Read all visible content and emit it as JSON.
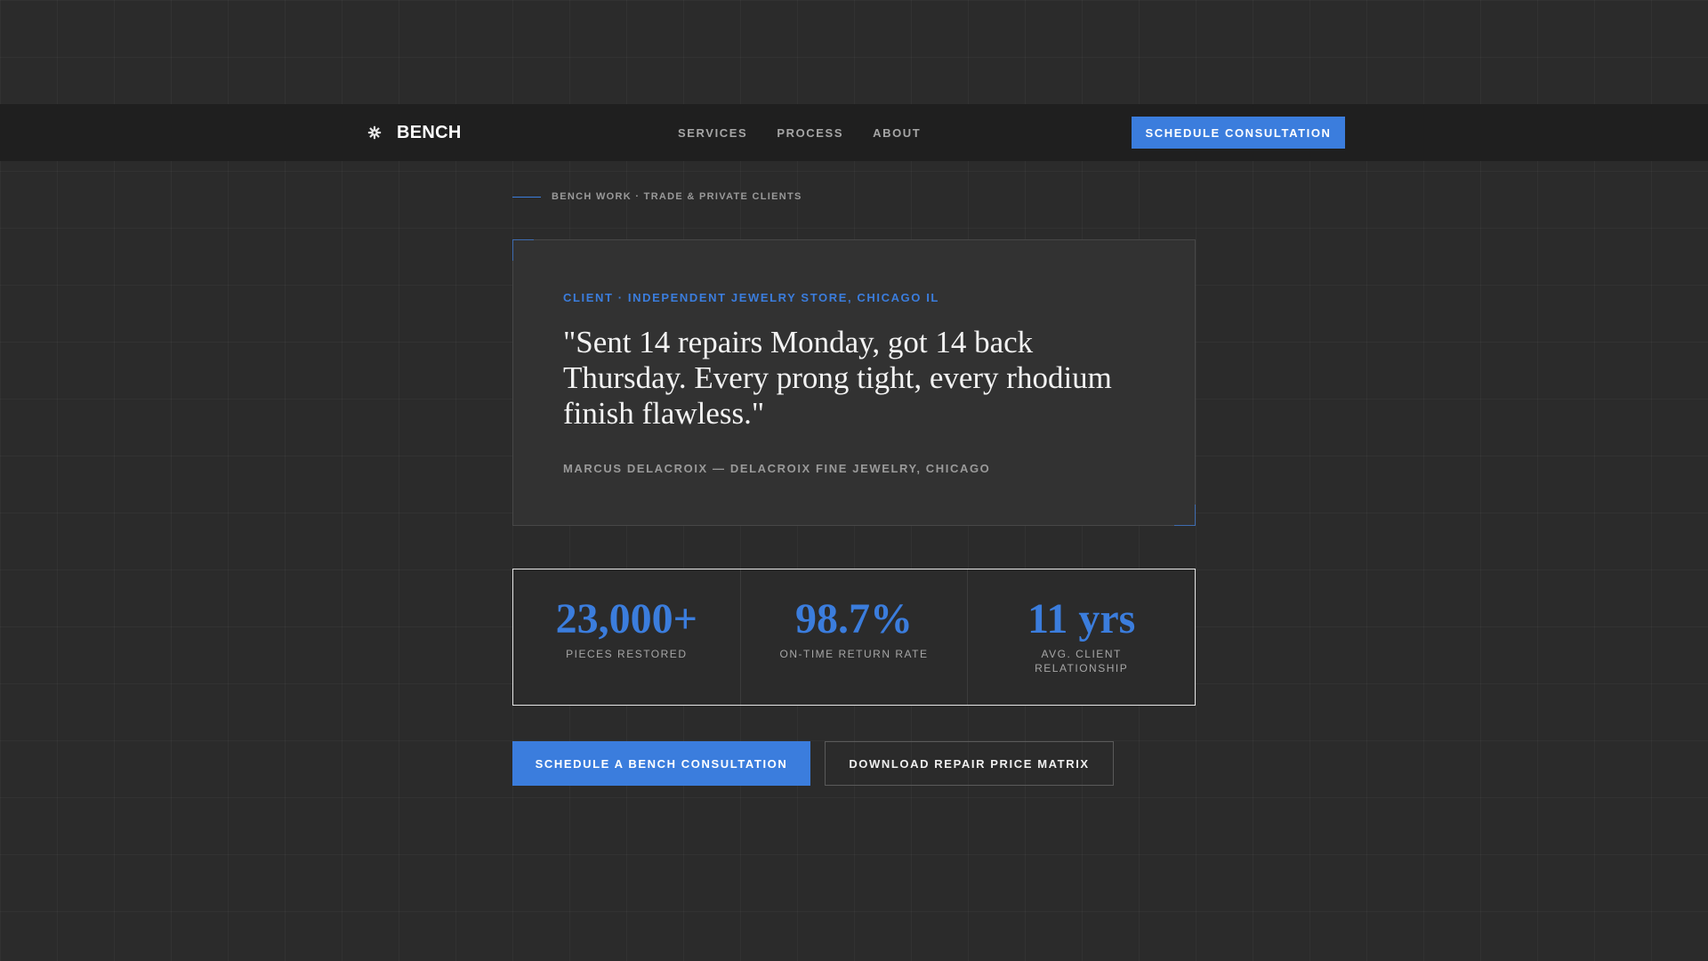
{
  "nav": {
    "brand": "BENCH",
    "brand_icon": "gear-icon",
    "links": [
      "SERVICES",
      "PROCESS",
      "ABOUT"
    ],
    "cta_label": "SCHEDULE CONSULTATION"
  },
  "eyebrow": "BENCH WORK · TRADE & PRIVATE CLIENTS",
  "testimonial": {
    "client_label": "CLIENT · INDEPENDENT JEWELRY STORE, CHICAGO IL",
    "quote": "\"Sent 14 repairs Monday, got 14 back Thursday. Every prong tight, every rhodium finish flawless.\"",
    "attribution": "MARCUS DELACROIX — DELACROIX FINE JEWELRY, CHICAGO"
  },
  "stats": [
    {
      "value": "23,000+",
      "label": "PIECES RESTORED"
    },
    {
      "value": "98.7%",
      "label": "ON-TIME RETURN RATE"
    },
    {
      "value": "11 yrs",
      "label": "AVG. CLIENT RELATIONSHIP"
    }
  ],
  "cta": {
    "primary": "SCHEDULE A BENCH CONSULTATION",
    "secondary": "DOWNLOAD REPAIR PRICE MATRIX"
  },
  "colors": {
    "accent": "#3b7ddd",
    "background": "#2b2b2b",
    "nav_background": "#1f1f1f",
    "card_background": "#323232"
  }
}
